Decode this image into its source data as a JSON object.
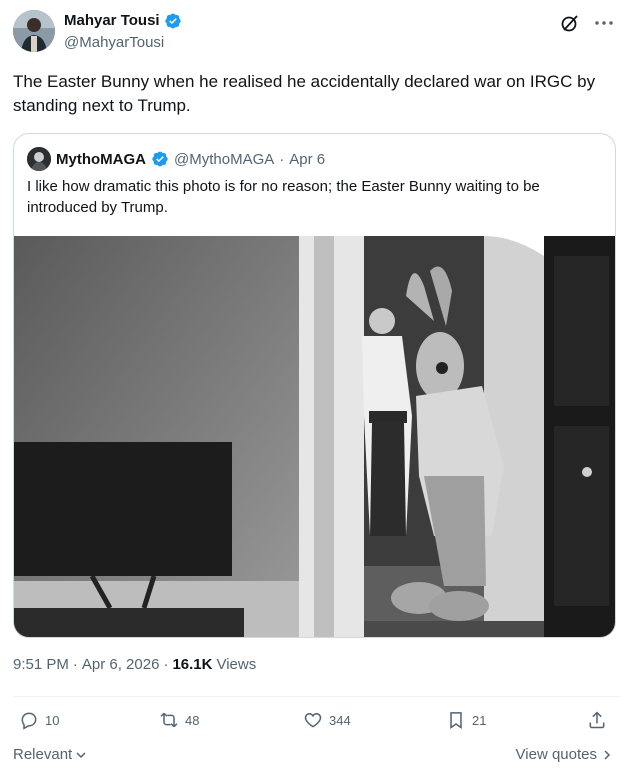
{
  "author": {
    "display_name": "Mahyar Tousi",
    "handle": "@MahyarTousi"
  },
  "tweet": {
    "text": "The Easter Bunny when he realised he accidentally declared war on IRGC by standing next to Trump."
  },
  "quote": {
    "display_name": "MythoMAGA",
    "handle": "@MythoMAGA",
    "separator": "·",
    "date": "Apr 6",
    "text": "I like how dramatic this photo is for no reason; the Easter Bunny waiting to be introduced by Trump."
  },
  "meta": {
    "time": "9:51 PM",
    "separator": "·",
    "date": "Apr 6, 2026",
    "views_count": "16.1K",
    "views_label": "Views"
  },
  "actions": {
    "replies": "10",
    "reposts": "48",
    "likes": "344",
    "bookmarks": "21"
  },
  "footer": {
    "sort_label": "Relevant",
    "view_quotes_label": "View quotes"
  },
  "colors": {
    "verified_blue": "#1d9bf0",
    "secondary_text": "#536471",
    "border": "#cfd9de"
  }
}
